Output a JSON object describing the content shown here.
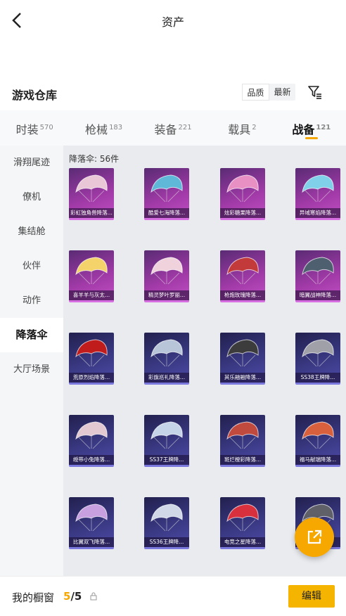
{
  "header": {
    "title": "资产"
  },
  "warehouse": {
    "title": "游戏仓库",
    "sort_options": [
      "品质",
      "最新"
    ]
  },
  "tabs": [
    {
      "label": "时装",
      "count": "570"
    },
    {
      "label": "枪械",
      "count": "183"
    },
    {
      "label": "装备",
      "count": "221"
    },
    {
      "label": "载具",
      "count": "2"
    },
    {
      "label": "战备",
      "count": "121"
    }
  ],
  "sidebar": {
    "items": [
      "滑翔尾迹",
      "僚机",
      "集结舱",
      "伙伴",
      "动作",
      "降落伞",
      "大厅场景"
    ]
  },
  "content": {
    "count_label": "降落伞: 56件",
    "items": [
      {
        "name": "彩虹独角兽降落...",
        "tier": "pink",
        "color": "#e9c7d6"
      },
      {
        "name": "酷爱七海降落...",
        "tier": "pink",
        "color": "#5fb8d8"
      },
      {
        "name": "炫彩糖果降落...",
        "tier": "pink",
        "color": "#e88fc4"
      },
      {
        "name": "异域寒焰降落...",
        "tier": "pink",
        "color": "#7fd0e8"
      },
      {
        "name": "喜羊羊与灰太...",
        "tier": "pink",
        "color": "#f3d36a"
      },
      {
        "name": "精灵梦叶罗丽...",
        "tier": "pink",
        "color": "#f0d2dc"
      },
      {
        "name": "枪炮玫瑰降落...",
        "tier": "pink",
        "color": "#c23a3a"
      },
      {
        "name": "暗翼战神降落...",
        "tier": "pink",
        "color": "#4e6070"
      },
      {
        "name": "荒原烈焰降落...",
        "tier": "blue",
        "color": "#c01c1c"
      },
      {
        "name": "彩旗巡礼降落...",
        "tier": "blue",
        "color": "#b8c4d8"
      },
      {
        "name": "其乐融融降落...",
        "tier": "blue",
        "color": "#3c3c3c"
      },
      {
        "name": "SS38王牌降...",
        "tier": "blue",
        "color": "#a0a0a8"
      },
      {
        "name": "绶带小兔降落...",
        "tier": "blue",
        "color": "#e2c8d0"
      },
      {
        "name": "SS37王牌降...",
        "tier": "blue",
        "color": "#c6d4e8"
      },
      {
        "name": "斑烂橙彩降落...",
        "tier": "blue",
        "color": "#c04a3e"
      },
      {
        "name": "福马献瑞降落...",
        "tier": "blue",
        "color": "#d8603c"
      },
      {
        "name": "比翼双飞降落...",
        "tier": "blue",
        "color": "#c8a0e0"
      },
      {
        "name": "SS36王牌降...",
        "tier": "blue",
        "color": "#d0d8e8"
      },
      {
        "name": "电竞之星降落...",
        "tier": "blue",
        "color": "#d8303c"
      },
      {
        "name": "",
        "tier": "blue",
        "color": "#606068"
      }
    ]
  },
  "bottom": {
    "title": "我的橱窗",
    "count_current": "5",
    "count_total": "/5",
    "edit_label": "编辑"
  },
  "colors": {
    "accent": "#f5a700",
    "pink_tier": "#a23aa8",
    "blue_tier": "#3b3a86"
  }
}
